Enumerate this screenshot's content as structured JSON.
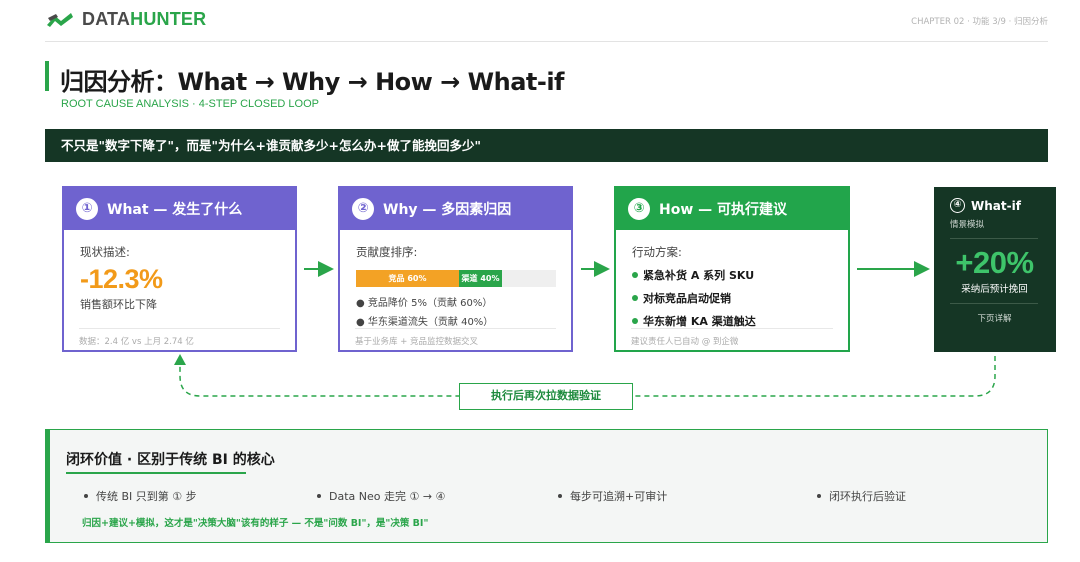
{
  "header": {
    "logo_text_a": "DATA",
    "logo_text_b": "HUNTER",
    "chapter": "CHAPTER 02 · 功能 3/9 · 归因分析"
  },
  "title": "归因分析：What → Why → How → What-if",
  "subtitle": "ROOT CAUSE ANALYSIS · 4-STEP CLOSED LOOP",
  "banner": "不只是\"数字下降了\"，而是\"为什么+谁贡献多少+怎么办+做了能挽回多少\"",
  "cards": {
    "what": {
      "num": "①",
      "title": "What — 发生了什么",
      "label": "现状描述:",
      "value": "-12.3%",
      "desc": "销售额环比下降",
      "foot": "数据：2.4 亿 vs 上月 2.74 亿"
    },
    "why": {
      "num": "②",
      "title": "Why — 多因素归因",
      "label": "贡献度排序:",
      "bar": [
        {
          "label": "竞品 60%",
          "share": 0.6
        },
        {
          "label": "渠道 40%",
          "share": 0.4
        }
      ],
      "bullets": [
        "竞品降价 5%（贡献 60%）",
        "华东渠道流失（贡献 40%）"
      ],
      "foot": "基于业务库 + 竞品监控数据交叉"
    },
    "how": {
      "num": "③",
      "title": "How — 可执行建议",
      "label": "行动方案:",
      "actions": [
        "紧急补货 A 系列 SKU",
        "对标竞品启动促销",
        "华东新增 KA 渠道触达"
      ],
      "foot": "建议责任人已自动 @ 到企微"
    },
    "whatif": {
      "num": "④",
      "title": "What-if",
      "sub": "情景模拟",
      "value": "+20%",
      "caption": "采纳后预计挽回",
      "link": "下页详解"
    }
  },
  "loop_label": "执行后再次拉数据验证",
  "panel": {
    "title": "闭环价值 · 区别于传统 BI 的核心",
    "points": [
      "传统 BI 只到第 ① 步",
      "Data Neo 走完 ① → ④",
      "每步可追溯+可审计",
      "闭环执行后验证"
    ],
    "note": "归因+建议+模拟，这才是\"决策大脑\"该有的样子 — 不是\"问数 BI\"，是\"决策 BI\""
  },
  "colors": {
    "brand_green": "#2aa54a",
    "dark_green": "#153625",
    "purple": "#6f63cf",
    "orange": "#f29a19"
  }
}
